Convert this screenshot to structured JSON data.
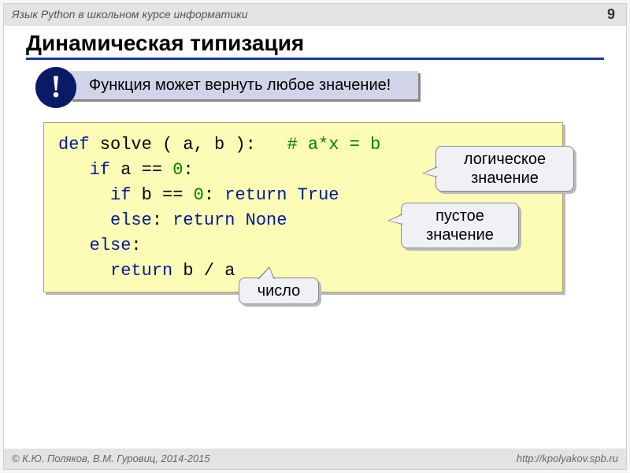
{
  "header": {
    "course": "Язык Python в школьном курсе информатики",
    "page": "9"
  },
  "title": "Динамическая типизация",
  "banner": {
    "mark": "!",
    "text": "Функция может вернуть любое значение!"
  },
  "code": {
    "l1_def": "def",
    "l1_rest": " solve ( a, b ):   ",
    "l1_comment": "# a*x = b",
    "l2_if": "if",
    "l2_rest": " a == ",
    "l2_zero": "0",
    "l2_colon": ":",
    "l3_if": "if",
    "l3_rest": " b == ",
    "l3_zero": "0",
    "l3_colon": ": ",
    "l3_return": "return",
    "l3_true": " True",
    "l4_else": "else",
    "l4_colon": ": ",
    "l4_return": "return",
    "l4_none": " None",
    "l5_else": "else",
    "l5_colon": ":",
    "l6_return": "return",
    "l6_expr": " b / a"
  },
  "callouts": {
    "logical": "логическое\nзначение",
    "empty": "пустое\nзначение",
    "number": "число"
  },
  "footer": {
    "left": "© К.Ю. Поляков, В.М. Гуровиц, 2014-2015",
    "right": "http://kpolyakov.spb.ru"
  }
}
